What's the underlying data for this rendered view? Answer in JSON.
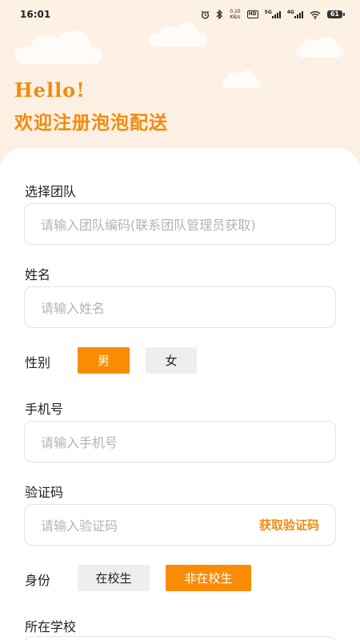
{
  "status_bar": {
    "time": "16:01",
    "speed_value": "0.10",
    "speed_unit": "KB/s",
    "hd_label": "HD",
    "net_5g": "5G",
    "net_4g": "4G",
    "battery": "61",
    "icons": [
      "alarm-icon",
      "bluetooth-icon",
      "signal-icon",
      "wifi-icon",
      "battery-icon"
    ]
  },
  "header": {
    "hello": "Hello!",
    "welcome": "欢迎注册泡泡配送"
  },
  "form": {
    "team": {
      "label": "选择团队",
      "placeholder": "请输入团队编码(联系团队管理员获取)"
    },
    "name": {
      "label": "姓名",
      "placeholder": "请输入姓名"
    },
    "gender": {
      "label": "性别",
      "options": [
        "男",
        "女"
      ],
      "selected": "男"
    },
    "phone": {
      "label": "手机号",
      "placeholder": "请输入手机号"
    },
    "code": {
      "label": "验证码",
      "placeholder": "请输入验证码",
      "button": "获取验证码"
    },
    "identity": {
      "label": "身份",
      "options": [
        "在校生",
        "非在校生"
      ],
      "selected": "非在校生"
    },
    "school": {
      "label": "所在学校"
    }
  },
  "colors": {
    "accent": "#f48b0c",
    "selected_bg": "#fa8c05",
    "unselected_bg": "#eeeeee",
    "page_bg": "#fdf3e9"
  }
}
